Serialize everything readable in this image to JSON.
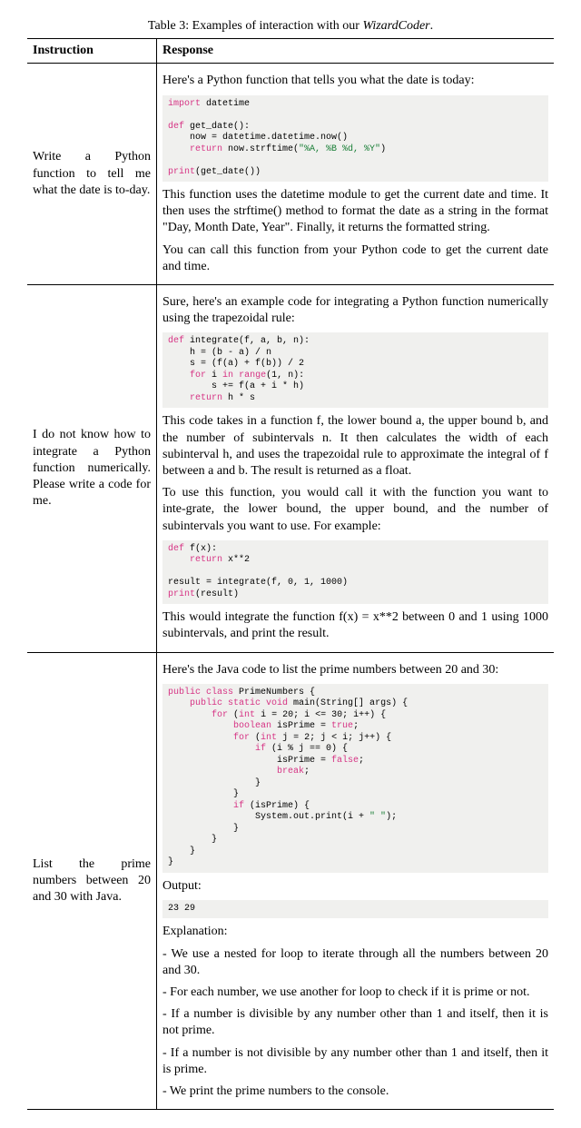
{
  "caption_prefix": "Table 3: Examples of interaction with our ",
  "caption_em": "WizardCoder",
  "caption_suffix": ".",
  "headers": {
    "instruction": "Instruction",
    "response": "Response"
  },
  "rows": [
    {
      "instruction": "Write a Python function to tell me what the date is to‑day.",
      "intro": "Here's a Python function that tells you what the date is today:",
      "code1_lines": [
        {
          "segs": [
            {
              "t": "import",
              "c": "kw-pink"
            },
            {
              "t": " datetime",
              "c": ""
            }
          ]
        },
        {
          "segs": [
            {
              "t": "",
              "c": ""
            }
          ]
        },
        {
          "segs": [
            {
              "t": "def",
              "c": "kw-pink"
            },
            {
              "t": " get_date():",
              "c": ""
            }
          ]
        },
        {
          "segs": [
            {
              "t": "    now = datetime.datetime.now()",
              "c": ""
            }
          ]
        },
        {
          "segs": [
            {
              "t": "    ",
              "c": ""
            },
            {
              "t": "return",
              "c": "kw-pink"
            },
            {
              "t": " now.strftime(",
              "c": ""
            },
            {
              "t": "\"%A, %B %d, %Y\"",
              "c": "kw-green"
            },
            {
              "t": ")",
              "c": ""
            }
          ]
        },
        {
          "segs": [
            {
              "t": "",
              "c": ""
            }
          ]
        },
        {
          "segs": [
            {
              "t": "print",
              "c": "kw-pink"
            },
            {
              "t": "(get_date())",
              "c": ""
            }
          ]
        }
      ],
      "para1": "This function uses the datetime module to get the current date and time. It then uses the strftime() method to format the date as a string in the format \"Day, Month Date, Year\". Finally, it returns the formatted string.",
      "para2": "You can call this function from your Python code to get the current date and time."
    },
    {
      "instruction": "I do not know how to integrate a Python function numerically. Please write a code for me.",
      "intro": "Sure, here's an example code for integrating a Python function numerically using the trapezoidal rule:",
      "code1_lines": [
        {
          "segs": [
            {
              "t": "def",
              "c": "kw-pink"
            },
            {
              "t": " integrate(f, a, b, n):",
              "c": ""
            }
          ]
        },
        {
          "segs": [
            {
              "t": "    h = (b - a) / n",
              "c": ""
            }
          ]
        },
        {
          "segs": [
            {
              "t": "    s = (f(a) + f(b)) / 2",
              "c": ""
            }
          ]
        },
        {
          "segs": [
            {
              "t": "    ",
              "c": ""
            },
            {
              "t": "for",
              "c": "kw-pink"
            },
            {
              "t": " i ",
              "c": ""
            },
            {
              "t": "in",
              "c": "kw-pink"
            },
            {
              "t": " ",
              "c": ""
            },
            {
              "t": "range",
              "c": "kw-pink"
            },
            {
              "t": "(1, n):",
              "c": ""
            }
          ]
        },
        {
          "segs": [
            {
              "t": "        s += f(a + i * h)",
              "c": ""
            }
          ]
        },
        {
          "segs": [
            {
              "t": "    ",
              "c": ""
            },
            {
              "t": "return",
              "c": "kw-pink"
            },
            {
              "t": " h * s",
              "c": ""
            }
          ]
        }
      ],
      "para1": "This code takes in a function f, the lower bound a, the upper bound b, and the number of subintervals n. It then calculates the width of each subinterval h, and uses the trapezoidal rule to approximate the integral of f between a and b. The result is returned as a float.",
      "para2": "To use this function, you would call it with the function you want to inte‑grate, the lower bound, the upper bound, and the number of subintervals you want to use. For example:",
      "code2_lines": [
        {
          "segs": [
            {
              "t": "def",
              "c": "kw-pink"
            },
            {
              "t": " f(x):",
              "c": ""
            }
          ]
        },
        {
          "segs": [
            {
              "t": "    ",
              "c": ""
            },
            {
              "t": "return",
              "c": "kw-pink"
            },
            {
              "t": " x**2",
              "c": ""
            }
          ]
        },
        {
          "segs": [
            {
              "t": "",
              "c": ""
            }
          ]
        },
        {
          "segs": [
            {
              "t": "result = integrate(f, 0, 1, 1000)",
              "c": ""
            }
          ]
        },
        {
          "segs": [
            {
              "t": "print",
              "c": "kw-pink"
            },
            {
              "t": "(result)",
              "c": ""
            }
          ]
        }
      ],
      "para3": "This would integrate the function f(x) = x**2 between 0 and 1 using 1000 subintervals, and print the result."
    },
    {
      "instruction": "List the prime numbers between 20 and 30 with Java.",
      "intro": "Here's the Java code to list the prime numbers between 20 and 30:",
      "code1_lines": [
        {
          "segs": [
            {
              "t": "public class",
              "c": "kw-pink"
            },
            {
              "t": " PrimeNumbers {",
              "c": ""
            }
          ]
        },
        {
          "segs": [
            {
              "t": "    ",
              "c": ""
            },
            {
              "t": "public static void",
              "c": "kw-pink"
            },
            {
              "t": " main(String[] args) {",
              "c": ""
            }
          ]
        },
        {
          "segs": [
            {
              "t": "        ",
              "c": ""
            },
            {
              "t": "for",
              "c": "kw-pink"
            },
            {
              "t": " (",
              "c": ""
            },
            {
              "t": "int",
              "c": "kw-pink"
            },
            {
              "t": " i = 20; i <= 30; i++) {",
              "c": ""
            }
          ]
        },
        {
          "segs": [
            {
              "t": "            ",
              "c": ""
            },
            {
              "t": "boolean",
              "c": "kw-pink"
            },
            {
              "t": " isPrime = ",
              "c": ""
            },
            {
              "t": "true",
              "c": "kw-pink"
            },
            {
              "t": ";",
              "c": ""
            }
          ]
        },
        {
          "segs": [
            {
              "t": "            ",
              "c": ""
            },
            {
              "t": "for",
              "c": "kw-pink"
            },
            {
              "t": " (",
              "c": ""
            },
            {
              "t": "int",
              "c": "kw-pink"
            },
            {
              "t": " j = 2; j < i; j++) {",
              "c": ""
            }
          ]
        },
        {
          "segs": [
            {
              "t": "                ",
              "c": ""
            },
            {
              "t": "if",
              "c": "kw-pink"
            },
            {
              "t": " (i % j == 0) {",
              "c": ""
            }
          ]
        },
        {
          "segs": [
            {
              "t": "                    isPrime = ",
              "c": ""
            },
            {
              "t": "false",
              "c": "kw-pink"
            },
            {
              "t": ";",
              "c": ""
            }
          ]
        },
        {
          "segs": [
            {
              "t": "                    ",
              "c": ""
            },
            {
              "t": "break",
              "c": "kw-pink"
            },
            {
              "t": ";",
              "c": ""
            }
          ]
        },
        {
          "segs": [
            {
              "t": "                }",
              "c": ""
            }
          ]
        },
        {
          "segs": [
            {
              "t": "            }",
              "c": ""
            }
          ]
        },
        {
          "segs": [
            {
              "t": "            ",
              "c": ""
            },
            {
              "t": "if",
              "c": "kw-pink"
            },
            {
              "t": " (isPrime) {",
              "c": ""
            }
          ]
        },
        {
          "segs": [
            {
              "t": "                System.out.print(i + ",
              "c": ""
            },
            {
              "t": "\" \"",
              "c": "kw-green"
            },
            {
              "t": ");",
              "c": ""
            }
          ]
        },
        {
          "segs": [
            {
              "t": "            }",
              "c": ""
            }
          ]
        },
        {
          "segs": [
            {
              "t": "        }",
              "c": ""
            }
          ]
        },
        {
          "segs": [
            {
              "t": "    }",
              "c": ""
            }
          ]
        },
        {
          "segs": [
            {
              "t": "}",
              "c": ""
            }
          ]
        }
      ],
      "output_label": "Output:",
      "output_code": "23 29",
      "explanation_label": "Explanation:",
      "bullets": [
        "- We use a nested for loop to iterate through all the numbers between 20 and 30.",
        "- For each number, we use another for loop to check if it is prime or not.",
        "- If a number is divisible by any number other than 1 and itself, then it is not prime.",
        "- If a number is not divisible by any number other than 1 and itself, then it is prime.",
        "- We print the prime numbers to the console."
      ]
    }
  ]
}
